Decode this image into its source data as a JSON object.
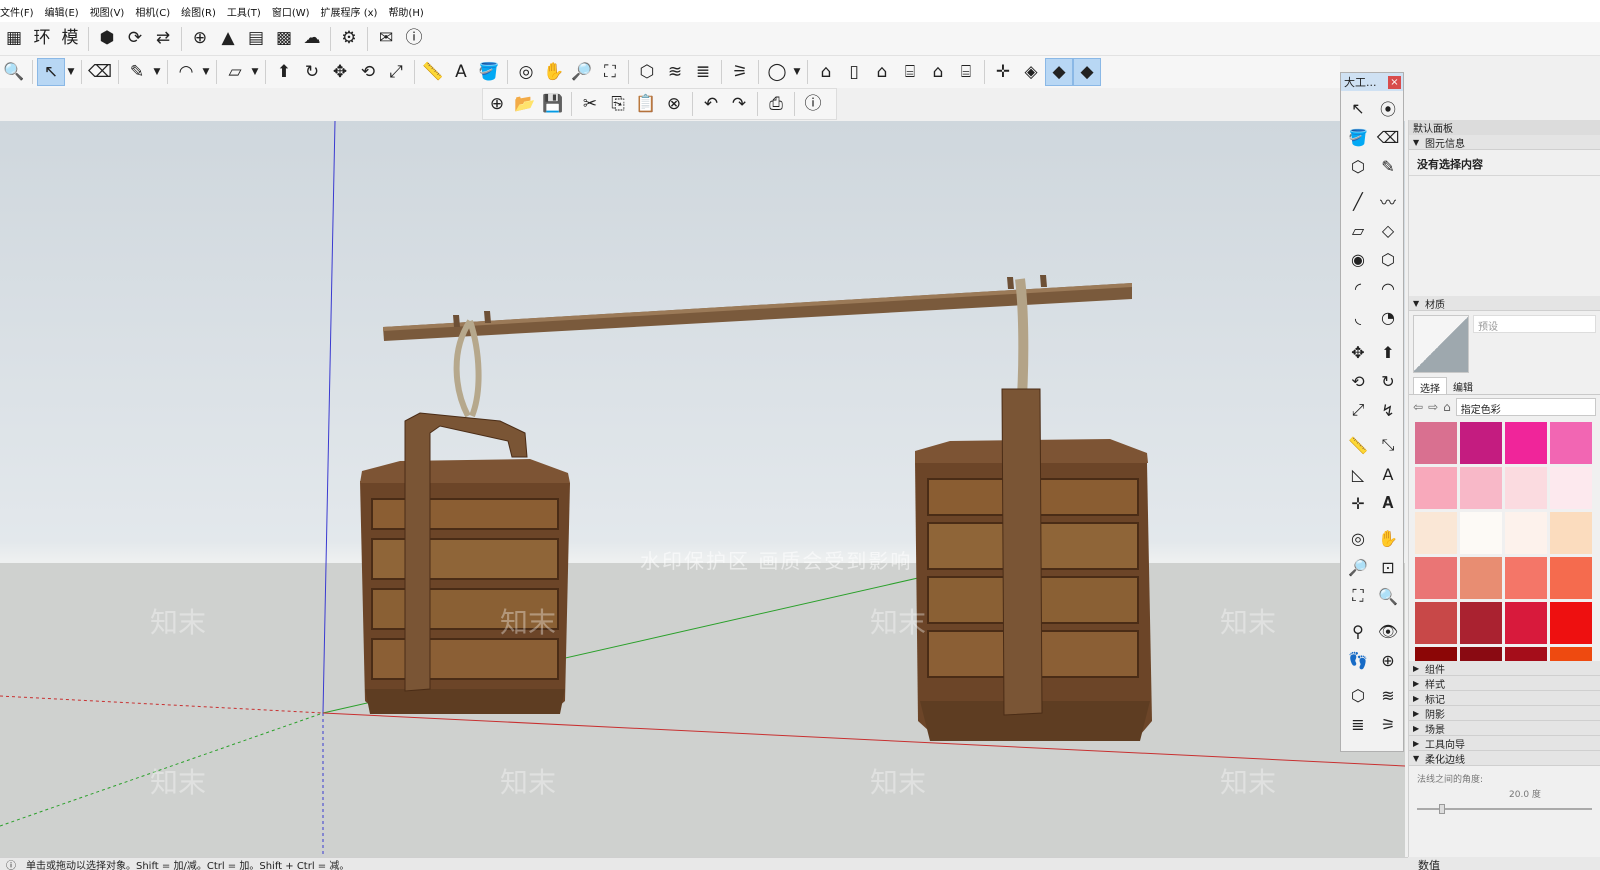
{
  "menu": [
    "文件(F)",
    "编辑(E)",
    "视图(V)",
    "相机(C)",
    "绘图(R)",
    "工具(T)",
    "窗口(W)",
    "扩展程序 (x)",
    "帮助(H)"
  ],
  "toolbar1": [
    {
      "name": "table-icon",
      "glyph": "▦"
    },
    {
      "name": "huan-icon",
      "glyph": "环"
    },
    {
      "name": "mo-icon",
      "glyph": "模"
    },
    {
      "name": "sep"
    },
    {
      "name": "plugin-icon",
      "glyph": "⬢"
    },
    {
      "name": "refresh-icon",
      "glyph": "⟳"
    },
    {
      "name": "transfer-icon",
      "glyph": "⇄"
    },
    {
      "name": "sep"
    },
    {
      "name": "add-circle-icon",
      "glyph": "⊕"
    },
    {
      "name": "tree-icon",
      "glyph": "▲"
    },
    {
      "name": "layers-icon",
      "glyph": "▤"
    },
    {
      "name": "checker-icon",
      "glyph": "▩"
    },
    {
      "name": "cloud-icon",
      "glyph": "☁"
    },
    {
      "name": "sep"
    },
    {
      "name": "gear-icon",
      "glyph": "⚙"
    },
    {
      "name": "sep"
    },
    {
      "name": "mail-icon",
      "glyph": "✉"
    },
    {
      "name": "info-icon",
      "glyph": "ⓘ"
    }
  ],
  "toolbar2": [
    {
      "name": "zoom-icon",
      "glyph": "🔍"
    },
    {
      "name": "sep"
    },
    {
      "name": "select-icon",
      "glyph": "↖",
      "active": true
    },
    {
      "name": "drop"
    },
    {
      "name": "sep"
    },
    {
      "name": "eraser-icon",
      "glyph": "⌫"
    },
    {
      "name": "sep"
    },
    {
      "name": "pencil-icon",
      "glyph": "✎"
    },
    {
      "name": "drop"
    },
    {
      "name": "sep"
    },
    {
      "name": "arc-icon",
      "glyph": "◠"
    },
    {
      "name": "drop"
    },
    {
      "name": "sep"
    },
    {
      "name": "rectangle-icon",
      "glyph": "▱"
    },
    {
      "name": "drop"
    },
    {
      "name": "sep"
    },
    {
      "name": "pushpull-icon",
      "glyph": "⬆"
    },
    {
      "name": "followme-icon",
      "glyph": "↻"
    },
    {
      "name": "move-icon",
      "glyph": "✥"
    },
    {
      "name": "rotate-icon",
      "glyph": "⟲"
    },
    {
      "name": "scale-icon",
      "glyph": "⤢"
    },
    {
      "name": "sep"
    },
    {
      "name": "tape-icon",
      "glyph": "📏"
    },
    {
      "name": "text-icon",
      "glyph": "A"
    },
    {
      "name": "paint-icon",
      "glyph": "🪣"
    },
    {
      "name": "sep"
    },
    {
      "name": "orbit-icon",
      "glyph": "◎"
    },
    {
      "name": "pan-icon",
      "glyph": "✋"
    },
    {
      "name": "zoom2-icon",
      "glyph": "🔎"
    },
    {
      "name": "zoom-extents-icon",
      "glyph": "⛶"
    },
    {
      "name": "sep"
    },
    {
      "name": "solid1-icon",
      "glyph": "⬡"
    },
    {
      "name": "solid2-icon",
      "glyph": "≋"
    },
    {
      "name": "solid3-icon",
      "glyph": "≣"
    },
    {
      "name": "sep"
    },
    {
      "name": "solid4-icon",
      "glyph": "⚞"
    },
    {
      "name": "sep"
    },
    {
      "name": "account-icon",
      "glyph": "◯"
    },
    {
      "name": "drop"
    },
    {
      "name": "sep"
    },
    {
      "name": "warehouse-icon",
      "glyph": "⌂"
    },
    {
      "name": "book-icon",
      "glyph": "▯"
    },
    {
      "name": "home-icon",
      "glyph": "⌂"
    },
    {
      "name": "view-front-icon",
      "glyph": "⌸"
    },
    {
      "name": "view-house-icon",
      "glyph": "⌂"
    },
    {
      "name": "view-side-icon",
      "glyph": "⌸"
    },
    {
      "name": "sep"
    },
    {
      "name": "axes-icon",
      "glyph": "✛"
    },
    {
      "name": "cube1-icon",
      "glyph": "◈"
    },
    {
      "name": "cube2-icon",
      "glyph": "◆",
      "active": true
    },
    {
      "name": "cube3-icon",
      "glyph": "◆",
      "active": true
    }
  ],
  "toolbar3": [
    {
      "name": "add-icon",
      "glyph": "⊕"
    },
    {
      "name": "open-icon",
      "glyph": "📂"
    },
    {
      "name": "save-icon",
      "glyph": "💾"
    },
    {
      "name": "sep"
    },
    {
      "name": "cut-icon",
      "glyph": "✂"
    },
    {
      "name": "copy-icon",
      "glyph": "⎘"
    },
    {
      "name": "paste-icon",
      "glyph": "📋"
    },
    {
      "name": "delete-icon",
      "glyph": "⊗"
    },
    {
      "name": "sep"
    },
    {
      "name": "undo-icon",
      "glyph": "↶"
    },
    {
      "name": "redo-icon",
      "glyph": "↷"
    },
    {
      "name": "sep"
    },
    {
      "name": "print-icon",
      "glyph": "⎙"
    },
    {
      "name": "sep"
    },
    {
      "name": "model-info-icon",
      "glyph": "ⓘ"
    }
  ],
  "toolset": {
    "title": "大工...",
    "close": "×",
    "tools": [
      {
        "name": "select-tool-icon",
        "glyph": "↖"
      },
      {
        "name": "orbit-tool-icon",
        "glyph": "⦿"
      },
      {
        "name": "paint-tool-icon",
        "glyph": "🪣"
      },
      {
        "name": "eraser-tool-icon",
        "glyph": "⌫"
      },
      {
        "name": "component-tool-icon",
        "glyph": "⬡",
        "gap": true
      },
      {
        "name": "tag-tool-icon",
        "glyph": "✎",
        "gap": true
      },
      {
        "name": "line-tool-icon",
        "glyph": "╱"
      },
      {
        "name": "freehand-tool-icon",
        "glyph": "〰"
      },
      {
        "name": "rect-tool-icon",
        "glyph": "▱"
      },
      {
        "name": "rotated-rect-tool-icon",
        "glyph": "◇"
      },
      {
        "name": "circle-tool-icon",
        "glyph": "◉"
      },
      {
        "name": "polygon-tool-icon",
        "glyph": "⬡"
      },
      {
        "name": "arc-tool-icon",
        "glyph": "◜"
      },
      {
        "name": "arc2-tool-icon",
        "glyph": "◠"
      },
      {
        "name": "arc3-tool-icon",
        "glyph": "◟",
        "gap": true
      },
      {
        "name": "pie-tool-icon",
        "glyph": "◔",
        "gap": true
      },
      {
        "name": "move-tool-icon",
        "glyph": "✥"
      },
      {
        "name": "pushpull-tool-icon",
        "glyph": "⬆"
      },
      {
        "name": "rotate-tool-icon",
        "glyph": "⟲"
      },
      {
        "name": "followme-tool-icon",
        "glyph": "↻"
      },
      {
        "name": "scale-tool-icon",
        "glyph": "⤢"
      },
      {
        "name": "offset-tool-icon",
        "glyph": "↯",
        "gap": true
      },
      {
        "name": "tape-tool-icon",
        "glyph": "📏"
      },
      {
        "name": "dimension-tool-icon",
        "glyph": "⤡"
      },
      {
        "name": "protractor-tool-icon",
        "glyph": "◺"
      },
      {
        "name": "text-tool-icon",
        "glyph": "A"
      },
      {
        "name": "axes-tool-icon",
        "glyph": "✛"
      },
      {
        "name": "3dtext-tool-icon",
        "glyph": "𝐀",
        "gap": true
      },
      {
        "name": "orbit2-tool-icon",
        "glyph": "◎"
      },
      {
        "name": "pan-tool-icon",
        "glyph": "✋"
      },
      {
        "name": "zoom-tool-icon",
        "glyph": "🔎"
      },
      {
        "name": "zoom-window-tool-icon",
        "glyph": "⊡"
      },
      {
        "name": "zoom-extents-tool-icon",
        "glyph": "⛶"
      },
      {
        "name": "previous-view-tool-icon",
        "glyph": "🔍",
        "gap": true
      },
      {
        "name": "position-camera-tool-icon",
        "glyph": "⚲"
      },
      {
        "name": "look-around-tool-icon",
        "glyph": "👁"
      },
      {
        "name": "walk-tool-icon",
        "glyph": "👣"
      },
      {
        "name": "section-tool-icon",
        "glyph": "⊕",
        "gap": true
      },
      {
        "name": "solid-union-tool-icon",
        "glyph": "⬡"
      },
      {
        "name": "solid-subtract-tool-icon",
        "glyph": "≋"
      },
      {
        "name": "solid-trim-tool-icon",
        "glyph": "≣"
      },
      {
        "name": "solid-split-tool-icon",
        "glyph": "⚞"
      }
    ]
  },
  "tray": {
    "title": "默认面板",
    "entity_info": "图元信息",
    "no_selection": "没有选择内容",
    "materials": "材质",
    "preset": "预设",
    "tab_select": "选择",
    "tab_edit": "编辑",
    "library": "指定色彩",
    "swatches": [
      "#d97090",
      "#c41c80",
      "#f0259a",
      "#f266b3",
      "#f8a9bb",
      "#f8b8c8",
      "#fbdbe0",
      "#fde9ee",
      "#fae7d6",
      "#fdfaf6",
      "#fdf2ec",
      "#fbdcbe",
      "#ea7575",
      "#e88d72",
      "#f47668",
      "#f56b4e",
      "#c84848",
      "#aa2230",
      "#d81a3c",
      "#ee1010",
      "#8c0606",
      "#8a0a12",
      "#a50d1a",
      "#ee4a10"
    ],
    "sections": [
      "组件",
      "样式",
      "标记",
      "阴影",
      "场景",
      "工具向导"
    ],
    "soften": "柔化边线",
    "soften_label": "法线之间的角度:",
    "soften_value": "20.0 度"
  },
  "status": {
    "info_icon": "ⓘ",
    "hint": "单击或拖动以选择对象。Shift = 加/减。Ctrl = 加。Shift + Ctrl = 减。",
    "measure_label": "数值"
  },
  "viewport": {
    "banner": "水印保护区 画质会受到影响",
    "watermark": "知末"
  }
}
